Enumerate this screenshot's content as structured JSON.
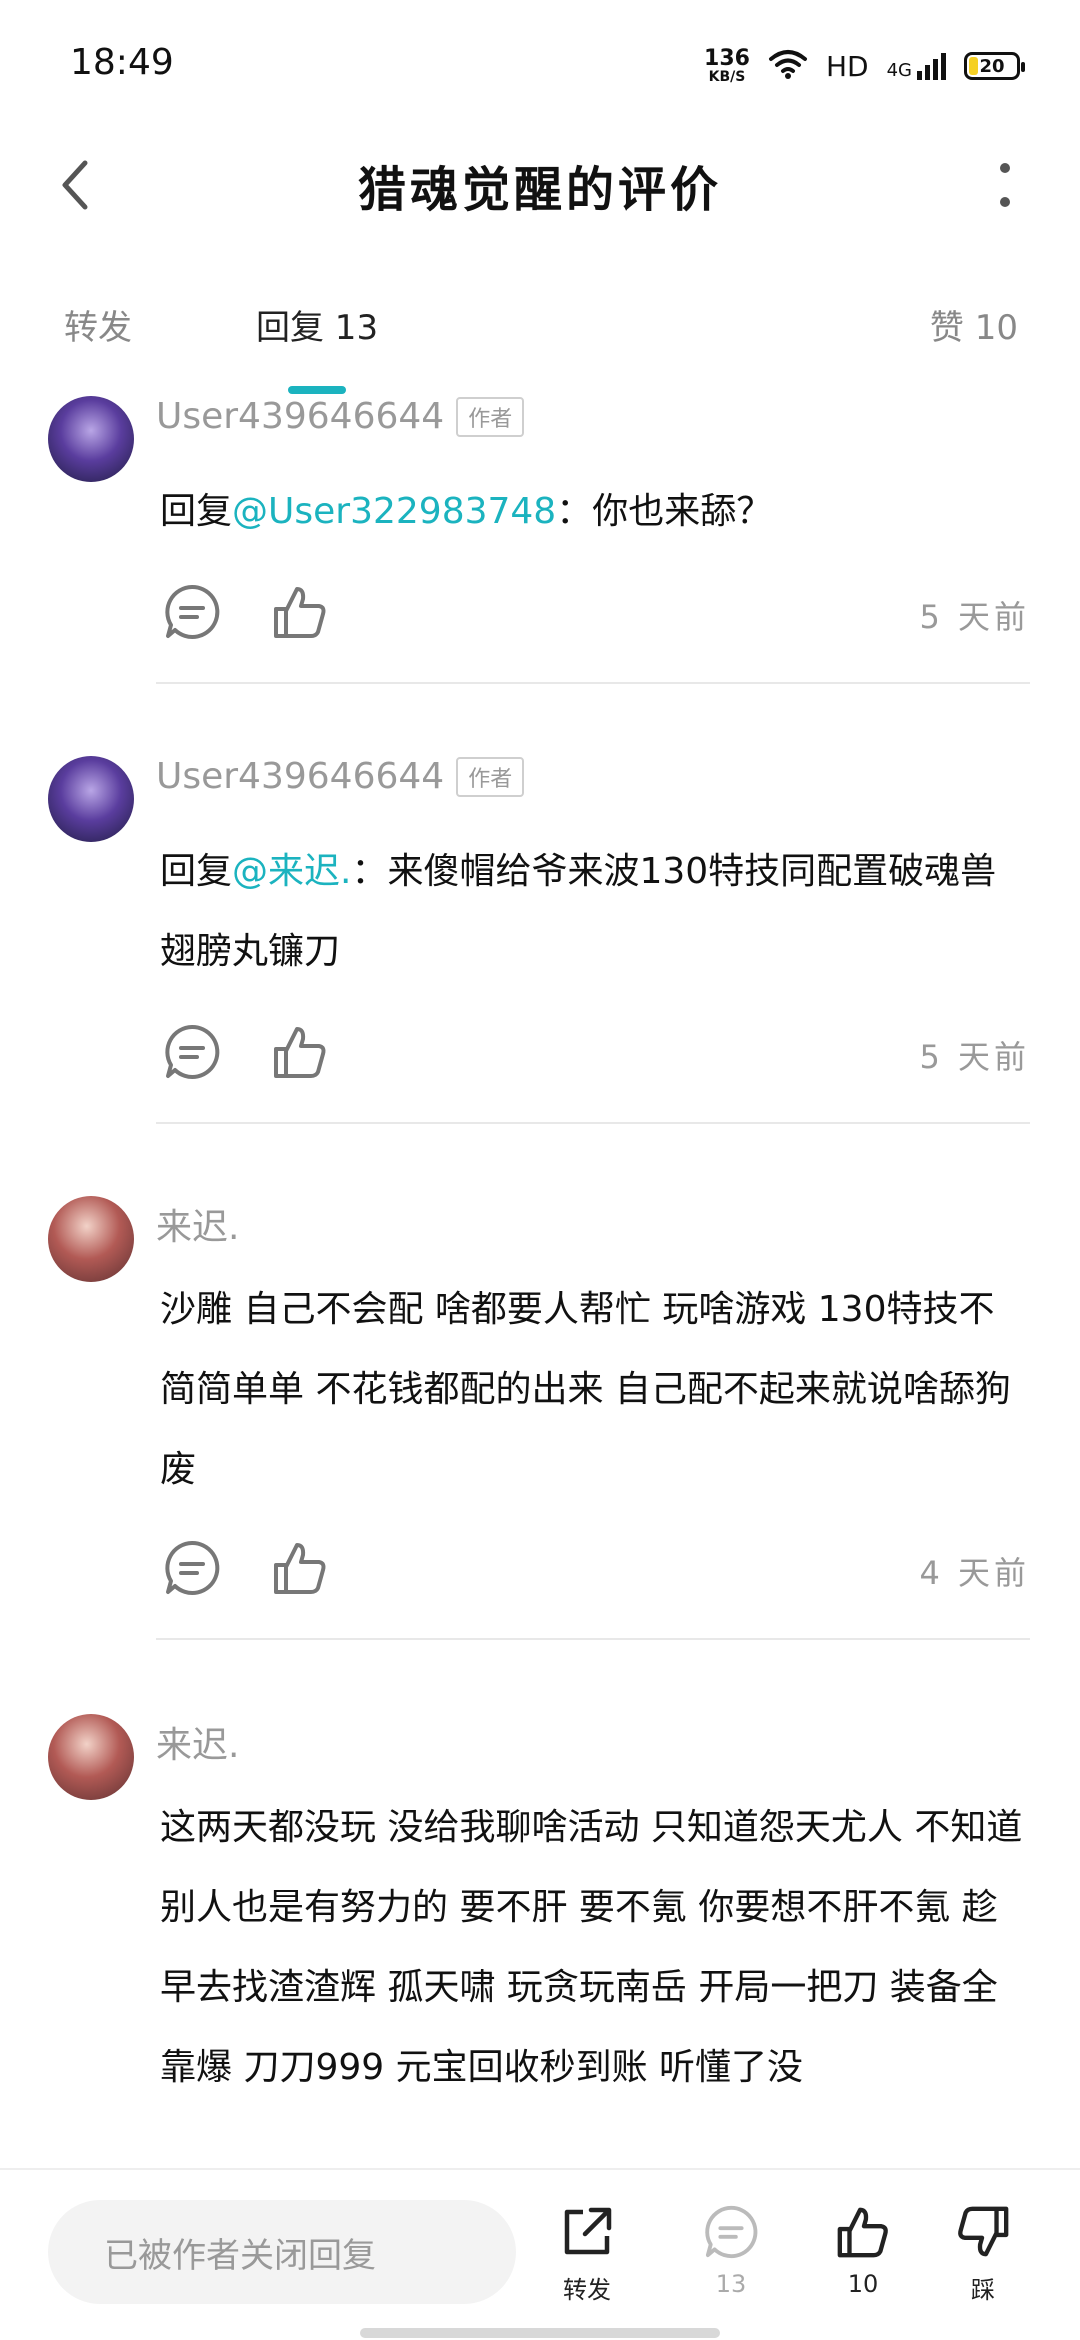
{
  "status_bar": {
    "time": "18:49",
    "net_speed_value": "136",
    "net_speed_unit": "KB/S",
    "hd_label": "HD",
    "network": "4G",
    "battery_level": "20",
    "battery_fraction": 0.2
  },
  "header": {
    "title": "猎魂觉醒的评价",
    "back_icon": "chevron-left-icon",
    "more_icon": "more-vertical-icon"
  },
  "tabs": {
    "forward_label": "转发",
    "reply_label": "回复 13",
    "likes_label": "赞 10",
    "active": "reply",
    "accent_color": "#1bb3bf"
  },
  "comments": [
    {
      "user": "User439646644",
      "badge": "作者",
      "prefix": "回复",
      "mention": "@User322983748",
      "text": "：你也来舔？",
      "time": "5 天前"
    },
    {
      "user": "User439646644",
      "badge": "作者",
      "prefix": "回复",
      "mention": "@来迟.",
      "text": "：来傻帽给爷来波130特技同配置破魂兽翅膀丸镰刀",
      "time": "5 天前"
    },
    {
      "user": "来迟.",
      "text": "沙雕 自己不会配 啥都要人帮忙 玩啥游戏 130特技不简简单单 不花钱都配的出来 自己配不起来就说啥舔狗 废",
      "time": "4 天前"
    },
    {
      "user": "来迟.",
      "text": "这两天都没玩 没给我聊啥活动 只知道怨天尤人 不知道别人也是有努力的 要不肝 要不氪 你要想不肝不氪 趁早去找渣渣辉 孤天啸 玩贪玩南岳 开局一把刀 装备全靠爆 刀刀999 元宝回收秒到账 听懂了没"
    }
  ],
  "bottom_bar": {
    "input_placeholder": "已被作者关闭回复",
    "forward_label": "转发",
    "reply_count": "13",
    "like_count": "10",
    "dislike_label": "踩"
  }
}
